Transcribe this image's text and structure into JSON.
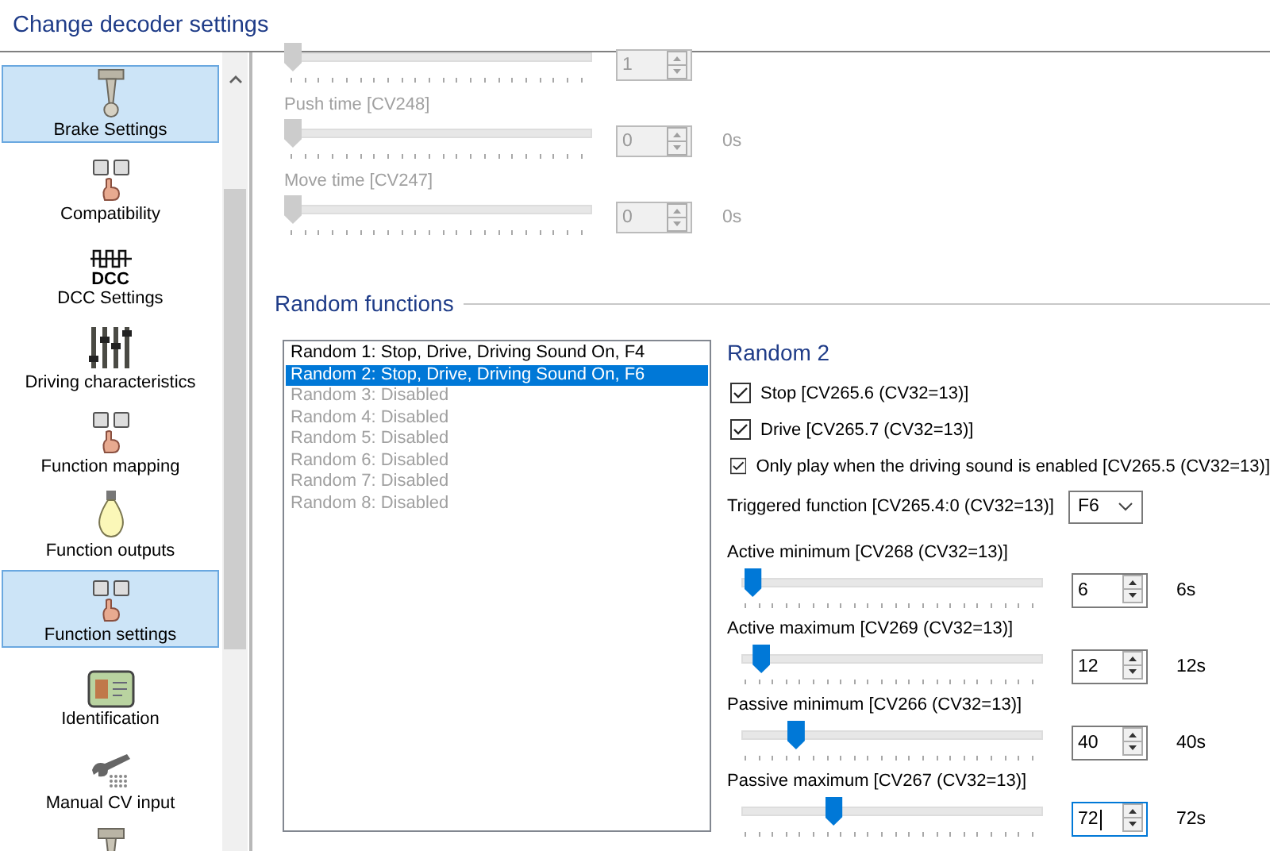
{
  "window": {
    "title": "Change decoder settings"
  },
  "sidebar": {
    "items": [
      {
        "kind": "piston",
        "label": "Brake Settings",
        "selected": true
      },
      {
        "kind": "function-keys",
        "label": "Compatibility",
        "selected": false
      },
      {
        "kind": "dcc",
        "icon_text": "DCC",
        "label": "DCC Settings",
        "selected": false
      },
      {
        "kind": "sliders",
        "label": "Driving characteristics",
        "selected": false
      },
      {
        "kind": "function-keys",
        "label": "Function mapping",
        "selected": false
      },
      {
        "kind": "bulb",
        "label": "Function outputs",
        "selected": false
      },
      {
        "kind": "function-keys",
        "label": "Function settings",
        "selected": true
      },
      {
        "kind": "id-card",
        "label": "Identification",
        "selected": false
      },
      {
        "kind": "wrench",
        "label": "Manual CV input",
        "selected": false
      },
      {
        "kind": "piston",
        "selected": false
      }
    ]
  },
  "brake_section": {
    "rows": [
      {
        "value": "1",
        "level": 0,
        "disabled": true
      },
      {
        "label": "Push time [CV248]",
        "value": "0",
        "unit": "0s",
        "level": 0,
        "disabled": true
      },
      {
        "label": "Move time [CV247]",
        "value": "0",
        "unit": "0s",
        "level": 0,
        "disabled": true
      }
    ]
  },
  "random_functions": {
    "title": "Random functions",
    "list": [
      {
        "text": "Random 1: Stop, Drive, Driving Sound On, F4",
        "selected": false,
        "disabled": false
      },
      {
        "text": "Random 2: Stop, Drive, Driving Sound On, F6",
        "selected": true,
        "disabled": false
      },
      {
        "text": "Random 3: Disabled",
        "selected": false,
        "disabled": true
      },
      {
        "text": "Random 4: Disabled",
        "selected": false,
        "disabled": true
      },
      {
        "text": "Random 5: Disabled",
        "selected": false,
        "disabled": true
      },
      {
        "text": "Random 6: Disabled",
        "selected": false,
        "disabled": true
      },
      {
        "text": "Random 7: Disabled",
        "selected": false,
        "disabled": true
      },
      {
        "text": "Random 8: Disabled",
        "selected": false,
        "disabled": true
      }
    ],
    "detail": {
      "title": "Random 2",
      "options": [
        {
          "label": "Stop [CV265.6 (CV32=13)]",
          "checked": true
        },
        {
          "label": "Drive [CV265.7 (CV32=13)]",
          "checked": true
        },
        {
          "label": "Only play when the driving sound is enabled [CV265.5 (CV32=13)]",
          "checked": true
        }
      ],
      "triggered_function": {
        "label": "Triggered function [CV265.4:0 (CV32=13)]",
        "value": "F6"
      },
      "sliders": [
        {
          "label": "Active minimum [CV268 (CV32=13)]",
          "value": "6",
          "unit": "6s",
          "level": 0.02,
          "disabled": false
        },
        {
          "label": "Active maximum [CV269 (CV32=13)]",
          "value": "12",
          "unit": "12s",
          "level": 0.05,
          "disabled": false
        },
        {
          "label": "Passive minimum [CV266 (CV32=13)]",
          "value": "40",
          "unit": "40s",
          "level": 0.17,
          "disabled": false
        },
        {
          "label": "Passive maximum [CV267 (CV32=13)]",
          "value": "72",
          "unit": "72s",
          "level": 0.3,
          "disabled": false,
          "focused": true
        }
      ]
    }
  }
}
